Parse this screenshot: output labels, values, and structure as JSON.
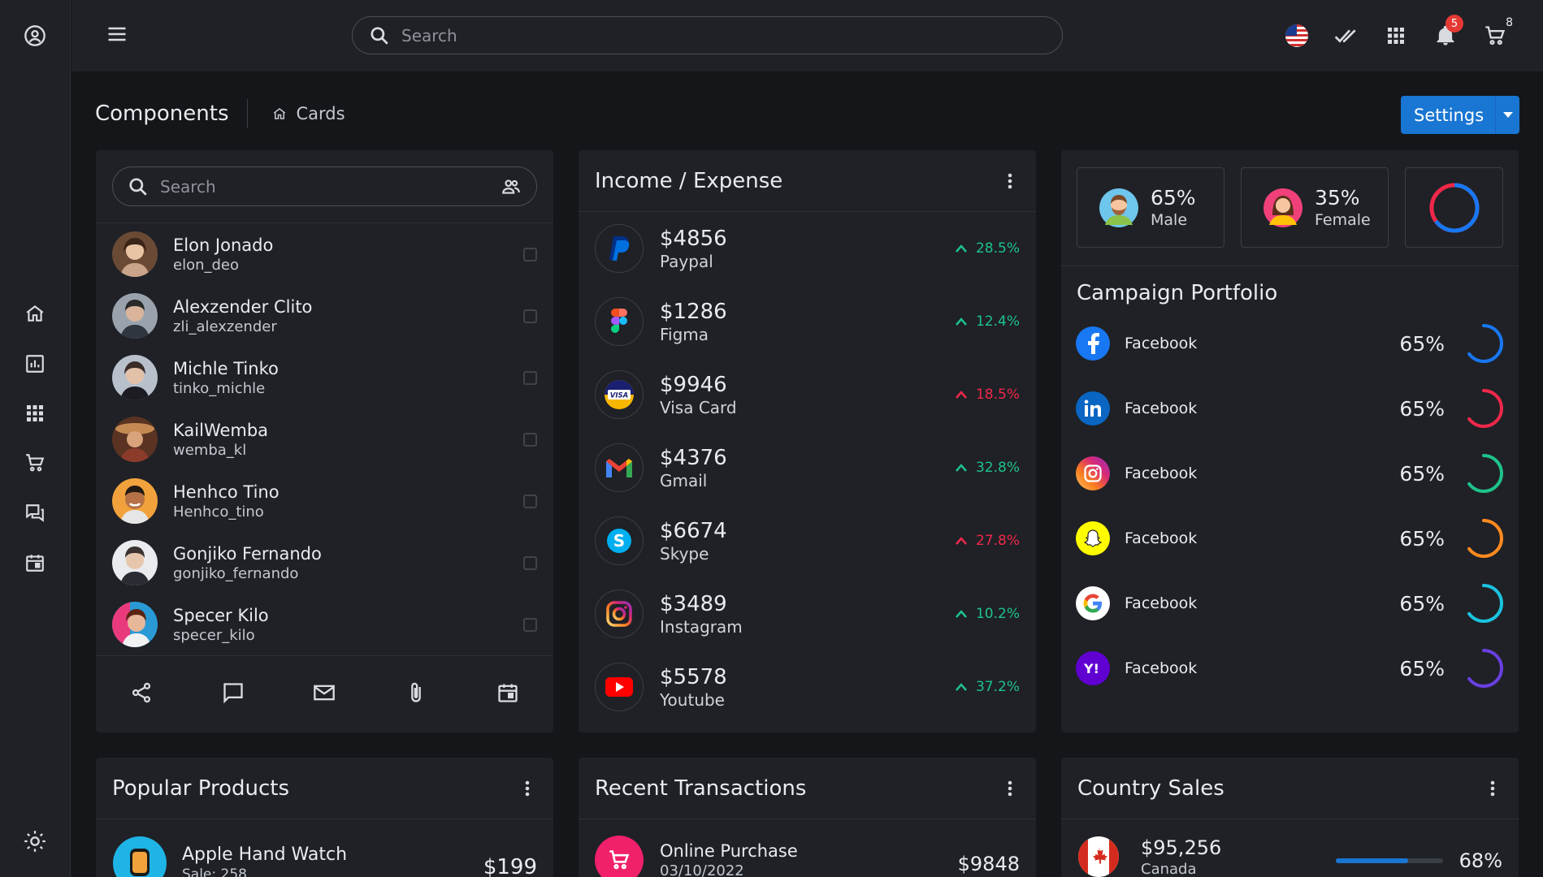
{
  "topbar": {
    "search_placeholder": "Search",
    "notification_count": "5",
    "cart_count": "8"
  },
  "breadcrumb": {
    "title": "Components",
    "current": "Cards"
  },
  "settings_label": "Settings",
  "users": {
    "search_placeholder": "Search",
    "items": [
      {
        "name": "Elon Jonado",
        "handle": "elon_deo"
      },
      {
        "name": "Alexzender Clito",
        "handle": "zli_alexzender"
      },
      {
        "name": "Michle Tinko",
        "handle": "tinko_michle"
      },
      {
        "name": "KailWemba",
        "handle": "wemba_kl"
      },
      {
        "name": "Henhco Tino",
        "handle": "Henhco_tino"
      },
      {
        "name": "Gonjiko Fernando",
        "handle": "gonjiko_fernando"
      },
      {
        "name": "Specer Kilo",
        "handle": "specer_kilo"
      }
    ]
  },
  "income": {
    "title": "Income / Expense",
    "items": [
      {
        "amount": "$4856",
        "source": "Paypal",
        "change": "28.5%",
        "trend": "up",
        "icon": "paypal-icon"
      },
      {
        "amount": "$1286",
        "source": "Figma",
        "change": "12.4%",
        "trend": "up",
        "icon": "figma-icon"
      },
      {
        "amount": "$9946",
        "source": "Visa Card",
        "change": "18.5%",
        "trend": "down",
        "icon": "visa-icon"
      },
      {
        "amount": "$4376",
        "source": "Gmail",
        "change": "32.8%",
        "trend": "up",
        "icon": "gmail-icon"
      },
      {
        "amount": "$6674",
        "source": "Skype",
        "change": "27.8%",
        "trend": "down",
        "icon": "skype-icon"
      },
      {
        "amount": "$3489",
        "source": "Instagram",
        "change": "10.2%",
        "trend": "up",
        "icon": "instagram-icon"
      },
      {
        "amount": "$5578",
        "source": "Youtube",
        "change": "37.2%",
        "trend": "up",
        "icon": "youtube-icon"
      }
    ]
  },
  "gender": {
    "male_pct": "65%",
    "male_label": "Male",
    "female_pct": "35%",
    "female_label": "Female",
    "male_fraction": 0.65
  },
  "campaign": {
    "title": "Campaign Portfolio",
    "items": [
      {
        "name": "Facebook",
        "pct": "65%",
        "icon": "facebook-icon",
        "color": "#1877f2",
        "fraction": 0.65
      },
      {
        "name": "Facebook",
        "pct": "65%",
        "icon": "linkedin-icon",
        "color": "#f0284a",
        "fraction": 0.65
      },
      {
        "name": "Facebook",
        "pct": "65%",
        "icon": "instagram-icon",
        "color": "#1ec28b",
        "fraction": 0.65
      },
      {
        "name": "Facebook",
        "pct": "65%",
        "icon": "snapchat-icon",
        "color": "#ff8a1f",
        "fraction": 0.65
      },
      {
        "name": "Facebook",
        "pct": "65%",
        "icon": "google-icon",
        "color": "#1ac3e0",
        "fraction": 0.65
      },
      {
        "name": "Facebook",
        "pct": "65%",
        "icon": "yahoo-icon",
        "color": "#6a3fe0",
        "fraction": 0.65
      }
    ]
  },
  "popular_products": {
    "title": "Popular Products",
    "first_name": "Apple Hand Watch",
    "first_sub": "Sale: 258",
    "first_price": "$199"
  },
  "recent_transactions": {
    "title": "Recent Transactions",
    "first_name": "Online Purchase",
    "first_date": "03/10/2022",
    "first_amount": "$9848"
  },
  "country_sales": {
    "title": "Country Sales",
    "first_amount": "$95,256",
    "first_country": "Canada",
    "first_pct": "68%",
    "first_fraction": 0.68
  },
  "colors": {
    "accent": "#1976d2",
    "up": "#1ec28b",
    "down": "#f0284a"
  }
}
